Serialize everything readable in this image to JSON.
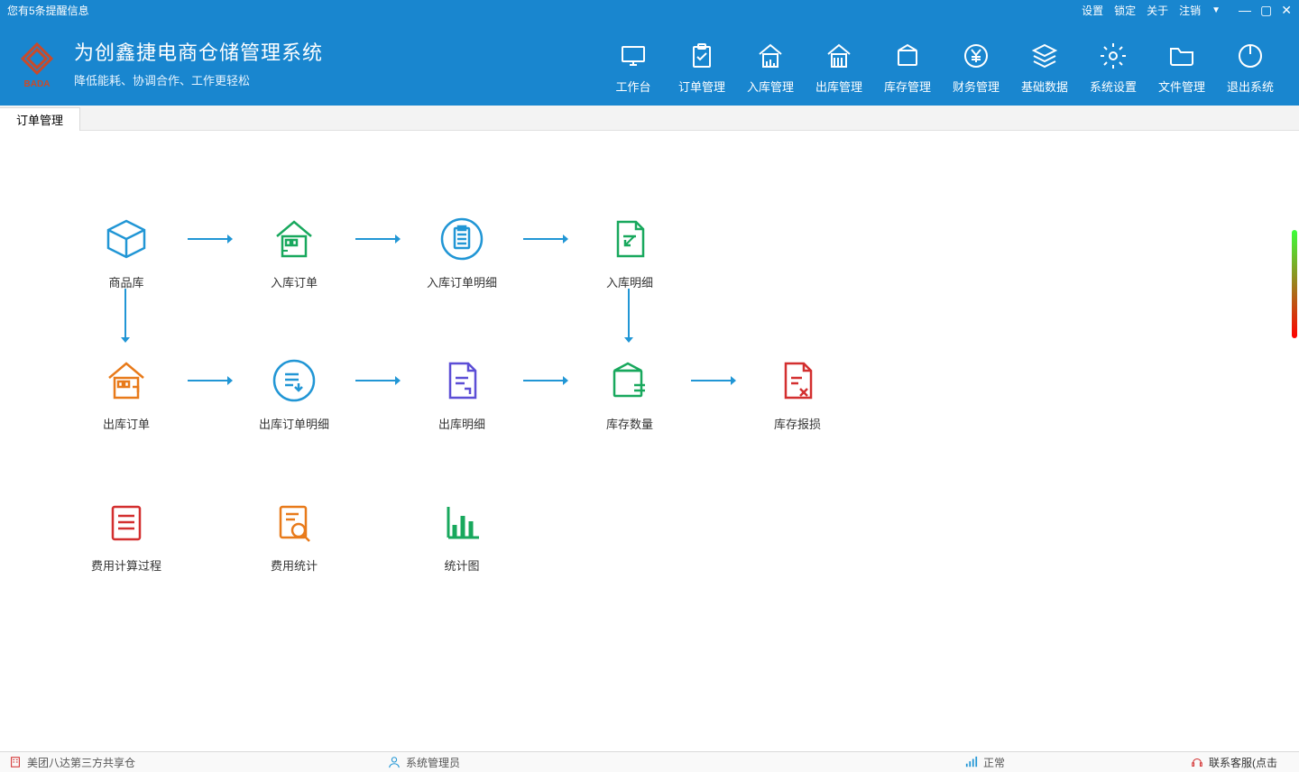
{
  "notify": "您有5条提醒信息",
  "top_links": {
    "settings": "设置",
    "lock": "锁定",
    "about": "关于",
    "logout": "注销"
  },
  "app_title": "为创鑫捷电商仓储管理系统",
  "app_subtitle": "降低能耗、协调合作、工作更轻松",
  "brand_text": "BADA",
  "nav": {
    "workbench": "工作台",
    "order": "订单管理",
    "inbound": "入库管理",
    "outbound": "出库管理",
    "stock": "库存管理",
    "finance": "财务管理",
    "basedata": "基础数据",
    "syssetting": "系统设置",
    "filemgmt": "文件管理",
    "exit": "退出系统"
  },
  "tab": {
    "current": "订单管理"
  },
  "flow": {
    "product_lib": "商品库",
    "in_orders": "入库订单",
    "in_order_detail": "入库订单明细",
    "in_detail": "入库明细",
    "out_orders": "出库订单",
    "out_order_detail": "出库订单明细",
    "out_detail": "出库明细",
    "stock_qty": "库存数量",
    "stock_loss": "库存报损",
    "fee_calc": "费用计算过程",
    "fee_stat": "费用统计",
    "stat_chart": "统计图"
  },
  "status": {
    "company": "美团八达第三方共享仓",
    "user": "系统管理员",
    "state": "正常",
    "support": "联系客服(点击"
  }
}
